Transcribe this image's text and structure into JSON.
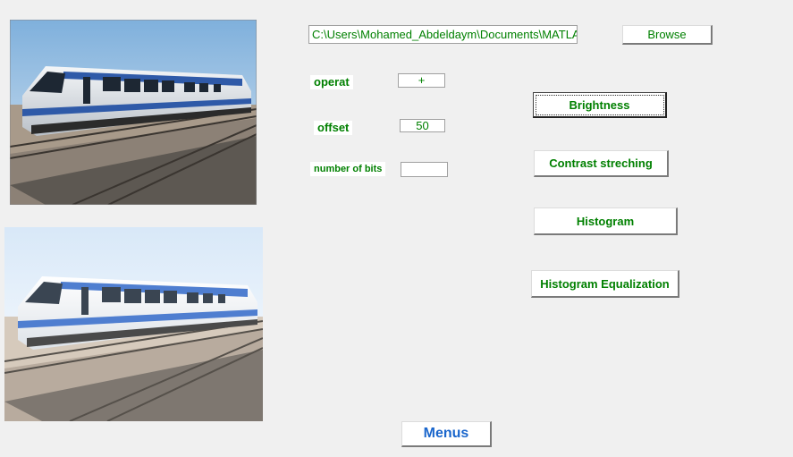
{
  "file_path": "C:\\Users\\Mohamed_Abdeldaym\\Documents\\MATLAB",
  "browse_label": "Browse",
  "operat": {
    "label": "operat",
    "value": "+"
  },
  "offset": {
    "label": "offset",
    "value": "50"
  },
  "bits": {
    "label": "number of bits",
    "value": ""
  },
  "buttons": {
    "brightness": "Brightness",
    "contrast": "Contrast streching",
    "histogram": "Histogram",
    "hist_eq": "Histogram Equalization",
    "menus": "Menus"
  },
  "colors": {
    "text_green": "#008000",
    "menus_blue": "#1a66cc",
    "background": "#f0f0f0"
  },
  "images": {
    "original": "train-photo",
    "processed": "train-photo-brightened"
  }
}
